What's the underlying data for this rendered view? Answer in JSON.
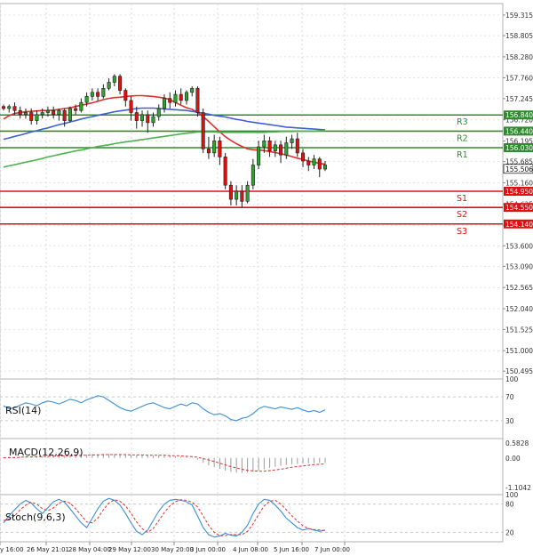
{
  "chart_data": {
    "type": "candlestick",
    "price_axis": {
      "range": [
        150.3,
        159.6
      ],
      "ticks": [
        "159.315",
        "158.805",
        "158.280",
        "157.760",
        "157.245",
        "156.720",
        "156.195",
        "155.685",
        "155.160",
        "154.635",
        "154.110",
        "153.600",
        "153.090",
        "152.565",
        "152.040",
        "151.525",
        "151.000",
        "150.495"
      ]
    },
    "time_axis": {
      "labels": [
        "y 16:00",
        "26 May 21:01",
        "28 May 04:00",
        "29 May 12:00",
        "30 May 20:00",
        "3 Jun 00:00",
        "4 Jun 08:00",
        "5 Jun 16:00",
        "7 Jun 00:00"
      ]
    },
    "candles": [
      [
        157.05,
        157.0,
        157.1,
        156.95
      ],
      [
        157.0,
        157.05,
        157.1,
        156.9
      ],
      [
        157.05,
        156.95,
        157.15,
        156.85
      ],
      [
        156.95,
        156.85,
        157.05,
        156.75
      ],
      [
        156.85,
        156.9,
        157.0,
        156.75
      ],
      [
        156.9,
        156.7,
        157.0,
        156.6
      ],
      [
        156.7,
        156.85,
        156.95,
        156.6
      ],
      [
        156.85,
        156.9,
        157.0,
        156.75
      ],
      [
        156.9,
        156.95,
        157.05,
        156.8
      ],
      [
        156.95,
        156.85,
        157.05,
        156.75
      ],
      [
        156.85,
        156.95,
        157.0,
        156.7
      ],
      [
        156.95,
        156.7,
        157.0,
        156.55
      ],
      [
        156.7,
        157.0,
        157.05,
        156.65
      ],
      [
        157.0,
        156.95,
        157.1,
        156.85
      ],
      [
        156.95,
        157.15,
        157.25,
        156.9
      ],
      [
        157.15,
        157.3,
        157.4,
        157.05
      ],
      [
        157.3,
        157.4,
        157.5,
        157.2
      ],
      [
        157.4,
        157.3,
        157.5,
        157.2
      ],
      [
        157.3,
        157.5,
        157.6,
        157.25
      ],
      [
        157.5,
        157.65,
        157.75,
        157.45
      ],
      [
        157.65,
        157.8,
        157.85,
        157.55
      ],
      [
        157.8,
        157.45,
        157.85,
        157.35
      ],
      [
        157.45,
        157.2,
        157.5,
        157.05
      ],
      [
        157.2,
        156.9,
        157.3,
        156.7
      ],
      [
        156.9,
        156.7,
        157.05,
        156.5
      ],
      [
        156.7,
        156.85,
        156.95,
        156.55
      ],
      [
        156.85,
        156.65,
        156.95,
        156.4
      ],
      [
        156.65,
        156.8,
        156.9,
        156.55
      ],
      [
        156.8,
        157.0,
        157.1,
        156.7
      ],
      [
        157.0,
        157.25,
        157.35,
        156.9
      ],
      [
        157.25,
        157.15,
        157.4,
        157.0
      ],
      [
        157.15,
        157.35,
        157.45,
        157.05
      ],
      [
        157.35,
        157.2,
        157.5,
        157.1
      ],
      [
        157.2,
        157.4,
        157.45,
        157.1
      ],
      [
        157.4,
        157.5,
        157.55,
        157.3
      ],
      [
        157.5,
        156.9,
        157.55,
        156.8
      ],
      [
        156.9,
        156.0,
        157.0,
        155.9
      ],
      [
        156.0,
        155.9,
        156.3,
        155.75
      ],
      [
        155.9,
        156.2,
        156.35,
        155.8
      ],
      [
        156.2,
        155.8,
        156.3,
        155.6
      ],
      [
        155.8,
        155.1,
        155.9,
        155.0
      ],
      [
        155.1,
        154.75,
        155.2,
        154.6
      ],
      [
        154.75,
        154.95,
        155.1,
        154.6
      ],
      [
        154.95,
        154.7,
        155.1,
        154.55
      ],
      [
        154.7,
        155.1,
        155.2,
        154.65
      ],
      [
        155.1,
        155.6,
        155.75,
        155.0
      ],
      [
        155.6,
        156.05,
        156.2,
        155.5
      ],
      [
        156.05,
        156.2,
        156.35,
        155.9
      ],
      [
        156.2,
        155.95,
        156.3,
        155.8
      ],
      [
        155.95,
        156.1,
        156.2,
        155.8
      ],
      [
        156.1,
        155.85,
        156.2,
        155.65
      ],
      [
        155.85,
        156.15,
        156.3,
        155.75
      ],
      [
        156.15,
        156.25,
        156.35,
        156.0
      ],
      [
        156.25,
        155.9,
        156.4,
        155.8
      ],
      [
        155.9,
        155.7,
        156.0,
        155.55
      ],
      [
        155.7,
        155.6,
        155.8,
        155.45
      ],
      [
        155.6,
        155.75,
        155.85,
        155.5
      ],
      [
        155.75,
        155.5,
        155.8,
        155.3
      ],
      [
        155.5,
        155.6,
        155.7,
        155.45
      ]
    ],
    "moving_averages": [
      {
        "color": "#e03030",
        "values": [
          156.74,
          156.82,
          156.88,
          156.9,
          156.92,
          156.93,
          156.94,
          156.95,
          156.95,
          156.96,
          156.98,
          157.0,
          157.02,
          157.05,
          157.08,
          157.11,
          157.14,
          157.18,
          157.22,
          157.25,
          157.27,
          157.28,
          157.3,
          157.31,
          157.32,
          157.32,
          157.31,
          157.3,
          157.28,
          157.26,
          157.22,
          157.15,
          157.08,
          157.02,
          156.98,
          156.9,
          156.8,
          156.68,
          156.55,
          156.42,
          156.3,
          156.21,
          156.13,
          156.06,
          156.0,
          155.98,
          155.97,
          155.96,
          155.93,
          155.91,
          155.88,
          155.85,
          155.81,
          155.77,
          155.74,
          155.7,
          155.67,
          155.64,
          155.62
        ]
      },
      {
        "color": "#4060d0",
        "values": [
          156.24,
          156.27,
          156.31,
          156.34,
          156.38,
          156.42,
          156.45,
          156.49,
          156.52,
          156.56,
          156.6,
          156.63,
          156.67,
          156.7,
          156.74,
          156.77,
          156.8,
          156.83,
          156.86,
          156.89,
          156.92,
          156.94,
          156.96,
          156.98,
          157.0,
          157.01,
          157.01,
          157.01,
          157.0,
          156.99,
          156.98,
          156.97,
          156.96,
          156.95,
          156.93,
          156.91,
          156.88,
          156.86,
          156.83,
          156.81,
          156.79,
          156.76,
          156.73,
          156.71,
          156.68,
          156.66,
          156.64,
          156.62,
          156.6,
          156.58,
          156.56,
          156.54,
          156.53,
          156.52,
          156.51,
          156.5,
          156.49,
          156.48,
          156.47
        ]
      },
      {
        "color": "#50b050",
        "values": [
          155.55,
          155.58,
          155.61,
          155.64,
          155.67,
          155.7,
          155.73,
          155.76,
          155.8,
          155.83,
          155.86,
          155.89,
          155.92,
          155.95,
          155.97,
          156.0,
          156.03,
          156.06,
          156.08,
          156.1,
          156.13,
          156.15,
          156.17,
          156.19,
          156.21,
          156.23,
          156.25,
          156.27,
          156.29,
          156.31,
          156.33,
          156.35,
          156.37,
          156.39,
          156.4,
          156.42,
          156.42,
          156.42,
          156.42,
          156.41,
          156.41,
          156.41,
          156.41,
          156.41,
          156.41,
          156.41,
          156.41,
          156.41,
          156.42,
          156.42,
          156.43,
          156.43,
          156.43,
          156.44,
          156.44,
          156.44,
          156.44,
          156.45,
          156.45
        ]
      }
    ],
    "levels": [
      {
        "name": "R3",
        "value": 156.84,
        "label": "156.840",
        "color": "#2e8b2e"
      },
      {
        "name": "R2",
        "value": 156.44,
        "label": "156.440",
        "color": "#2e8b2e"
      },
      {
        "name": "R1",
        "value": 156.03,
        "label": "156.030",
        "color": "#2e8b2e"
      },
      {
        "name": "S1",
        "value": 154.95,
        "label": "154.950",
        "color": "#e01010"
      },
      {
        "name": "S2",
        "value": 154.55,
        "label": "154.550",
        "color": "#e01010"
      },
      {
        "name": "S3",
        "value": 154.14,
        "label": "154.140",
        "color": "#e01010"
      }
    ],
    "current_price": {
      "value": 155.506,
      "label": "155.506"
    },
    "rsi": {
      "title": "RSI(14)",
      "range": [
        0,
        100
      ],
      "ticks": [
        "100",
        "70",
        "30",
        "0"
      ],
      "levels": [
        30,
        70
      ],
      "color": "#3a8fd8",
      "values": [
        55,
        50,
        52,
        56,
        60,
        58,
        55,
        60,
        63,
        61,
        58,
        62,
        66,
        64,
        60,
        65,
        68,
        72,
        70,
        64,
        58,
        52,
        48,
        46,
        50,
        54,
        58,
        60,
        56,
        52,
        50,
        54,
        58,
        55,
        60,
        58,
        50,
        44,
        40,
        42,
        38,
        32,
        30,
        34,
        36,
        42,
        50,
        54,
        52,
        50,
        53,
        51,
        49,
        52,
        48,
        45,
        47,
        44,
        48
      ]
    },
    "macd": {
      "title": "MACD(12,26,9)",
      "range": [
        -1.1042,
        0.5828
      ],
      "ticks": [
        "0.5828",
        "0.00",
        "-1.1042"
      ],
      "hist_color": "#9a9a9a",
      "signal_color": "#e03030",
      "hist": [
        0.02,
        0.03,
        0.03,
        0.04,
        0.05,
        0.05,
        0.06,
        0.06,
        0.07,
        0.07,
        0.08,
        0.08,
        0.09,
        0.09,
        0.1,
        0.1,
        0.11,
        0.11,
        0.12,
        0.12,
        0.11,
        0.1,
        0.1,
        0.09,
        0.08,
        0.08,
        0.07,
        0.07,
        0.08,
        0.07,
        0.06,
        0.05,
        0.04,
        0.03,
        0.01,
        -0.05,
        -0.15,
        -0.22,
        -0.28,
        -0.33,
        -0.38,
        -0.42,
        -0.44,
        -0.45,
        -0.44,
        -0.42,
        -0.38,
        -0.34,
        -0.3,
        -0.27,
        -0.24,
        -0.21,
        -0.19,
        -0.18,
        -0.17,
        -0.16,
        -0.16,
        -0.15,
        -0.15
      ],
      "signal": [
        0.0,
        0.01,
        0.01,
        0.02,
        0.03,
        0.03,
        0.04,
        0.04,
        0.05,
        0.05,
        0.06,
        0.06,
        0.07,
        0.07,
        0.08,
        0.08,
        0.09,
        0.09,
        0.1,
        0.1,
        0.1,
        0.1,
        0.1,
        0.09,
        0.09,
        0.09,
        0.08,
        0.08,
        0.08,
        0.08,
        0.07,
        0.07,
        0.06,
        0.05,
        0.04,
        0.02,
        -0.02,
        -0.06,
        -0.11,
        -0.16,
        -0.21,
        -0.26,
        -0.3,
        -0.34,
        -0.37,
        -0.39,
        -0.4,
        -0.4,
        -0.38,
        -0.36,
        -0.34,
        -0.31,
        -0.28,
        -0.26,
        -0.24,
        -0.22,
        -0.2,
        -0.19,
        -0.18
      ]
    },
    "stoch": {
      "title": "Stoch(9,6,3)",
      "range": [
        0,
        100
      ],
      "ticks": [
        "100",
        "80",
        "20",
        "0"
      ],
      "levels": [
        20,
        80
      ],
      "k_color": "#3a8fd8",
      "d_color": "#e03030",
      "k": [
        40,
        55,
        68,
        80,
        88,
        82,
        70,
        60,
        72,
        85,
        90,
        84,
        70,
        55,
        40,
        30,
        50,
        70,
        86,
        92,
        88,
        78,
        60,
        40,
        22,
        15,
        25,
        45,
        65,
        80,
        88,
        90,
        88,
        85,
        78,
        55,
        30,
        15,
        10,
        12,
        18,
        14,
        12,
        20,
        35,
        60,
        80,
        90,
        88,
        78,
        65,
        50,
        40,
        30,
        25,
        28,
        25,
        22,
        25
      ],
      "d": [
        45,
        48,
        55,
        68,
        78,
        84,
        80,
        70,
        66,
        72,
        82,
        86,
        82,
        70,
        56,
        42,
        40,
        50,
        68,
        82,
        89,
        86,
        76,
        60,
        42,
        28,
        20,
        28,
        45,
        62,
        76,
        85,
        89,
        88,
        84,
        74,
        55,
        35,
        20,
        13,
        13,
        15,
        15,
        15,
        22,
        38,
        58,
        76,
        86,
        88,
        80,
        68,
        55,
        44,
        34,
        28,
        26,
        25,
        24
      ]
    }
  }
}
